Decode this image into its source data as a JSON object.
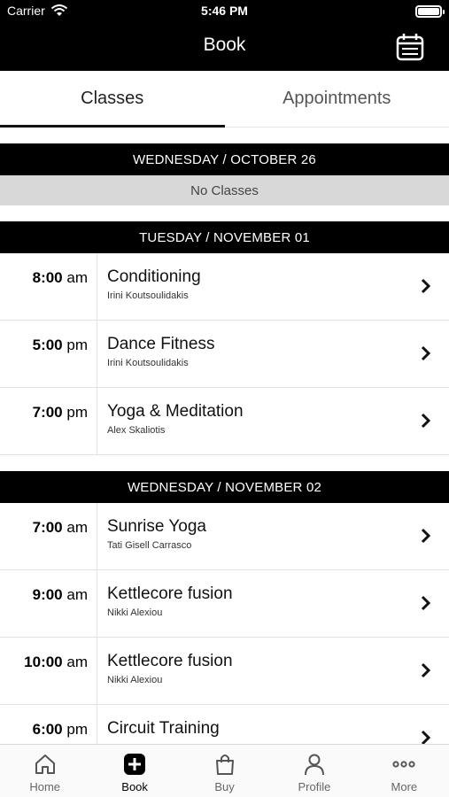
{
  "status": {
    "carrier": "Carrier",
    "time": "5:46 PM"
  },
  "nav": {
    "title": "Book"
  },
  "tabs": [
    {
      "label": "Classes"
    },
    {
      "label": "Appointments"
    }
  ],
  "days": [
    {
      "header": "WEDNESDAY / OCTOBER 26",
      "empty": "No Classes"
    },
    {
      "header": "TUESDAY / NOVEMBER 01"
    },
    {
      "header": "WEDNESDAY / NOVEMBER 02"
    }
  ],
  "classes": [
    {
      "time": "8:00",
      "ampm": "am",
      "name": "Conditioning",
      "instructor": "Irini Koutsoulidakis"
    },
    {
      "time": "5:00",
      "ampm": "pm",
      "name": "Dance Fitness",
      "instructor": "Irini Koutsoulidakis"
    },
    {
      "time": "7:00",
      "ampm": "pm",
      "name": "Yoga & Meditation",
      "instructor": "Alex Skaliotis"
    },
    {
      "time": "7:00",
      "ampm": "am",
      "name": "Sunrise Yoga",
      "instructor": "Tati Gisell Carrasco"
    },
    {
      "time": "9:00",
      "ampm": "am",
      "name": "Kettlecore fusion",
      "instructor": "Nikki Alexiou"
    },
    {
      "time": "10:00",
      "ampm": "am",
      "name": "Kettlecore fusion",
      "instructor": "Nikki Alexiou"
    },
    {
      "time": "6:00",
      "ampm": "pm",
      "name": "Circuit Training",
      "instructor": ""
    }
  ],
  "tabbar": [
    {
      "label": "Home",
      "icon": "home-icon"
    },
    {
      "label": "Book",
      "icon": "plus-square-icon"
    },
    {
      "label": "Buy",
      "icon": "shopping-bag-icon"
    },
    {
      "label": "Profile",
      "icon": "person-icon"
    },
    {
      "label": "More",
      "icon": "more-icon"
    }
  ]
}
